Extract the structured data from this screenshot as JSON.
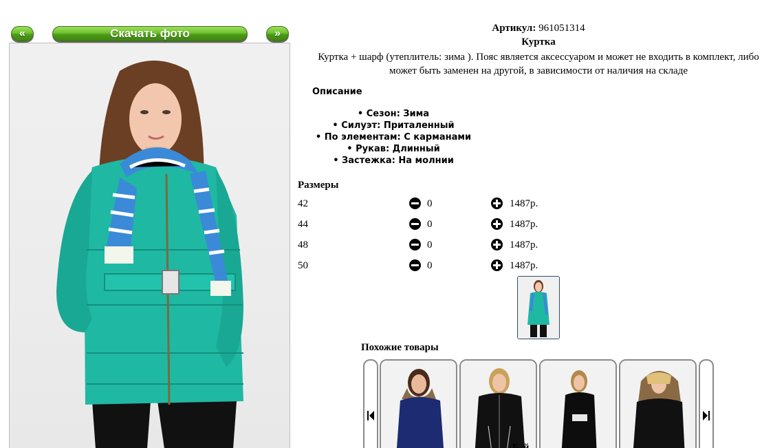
{
  "gallery": {
    "prev_label": "«",
    "next_label": "»",
    "download_label": "Скачать фото"
  },
  "product": {
    "article_label": "Артикул:",
    "article_value": "961051314",
    "name": "Куртка",
    "description": "Куртка + шарф (утеплитель: зима ). Пояс является аксессуаром и может не входить в комплект, либо может быть заменен на другой, в зависимости от наличия на складе",
    "description_heading": "Описание",
    "properties": [
      "• Сезон: Зима",
      "• Силуэт: Приталенный",
      "• По элементам: С карманами",
      "• Рукав: Длинный",
      "• Застежка: На молнии"
    ],
    "jacket_color": "#1fb8a3"
  },
  "sizes": {
    "heading": "Размеры",
    "rows": [
      {
        "size": "42",
        "qty": "0",
        "price": "1487р."
      },
      {
        "size": "44",
        "qty": "0",
        "price": "1487р."
      },
      {
        "size": "48",
        "qty": "0",
        "price": "1487р."
      },
      {
        "size": "50",
        "qty": "0",
        "price": "1487р."
      }
    ]
  },
  "similar": {
    "heading": "Похожие товары",
    "cards": [
      {
        "jacket_color": "#1d2b72"
      },
      {
        "jacket_color": "#111111"
      },
      {
        "jacket_color": "#0d0d0d"
      },
      {
        "jacket_color": "#111111"
      }
    ]
  },
  "footer_fragment": "Б..й"
}
